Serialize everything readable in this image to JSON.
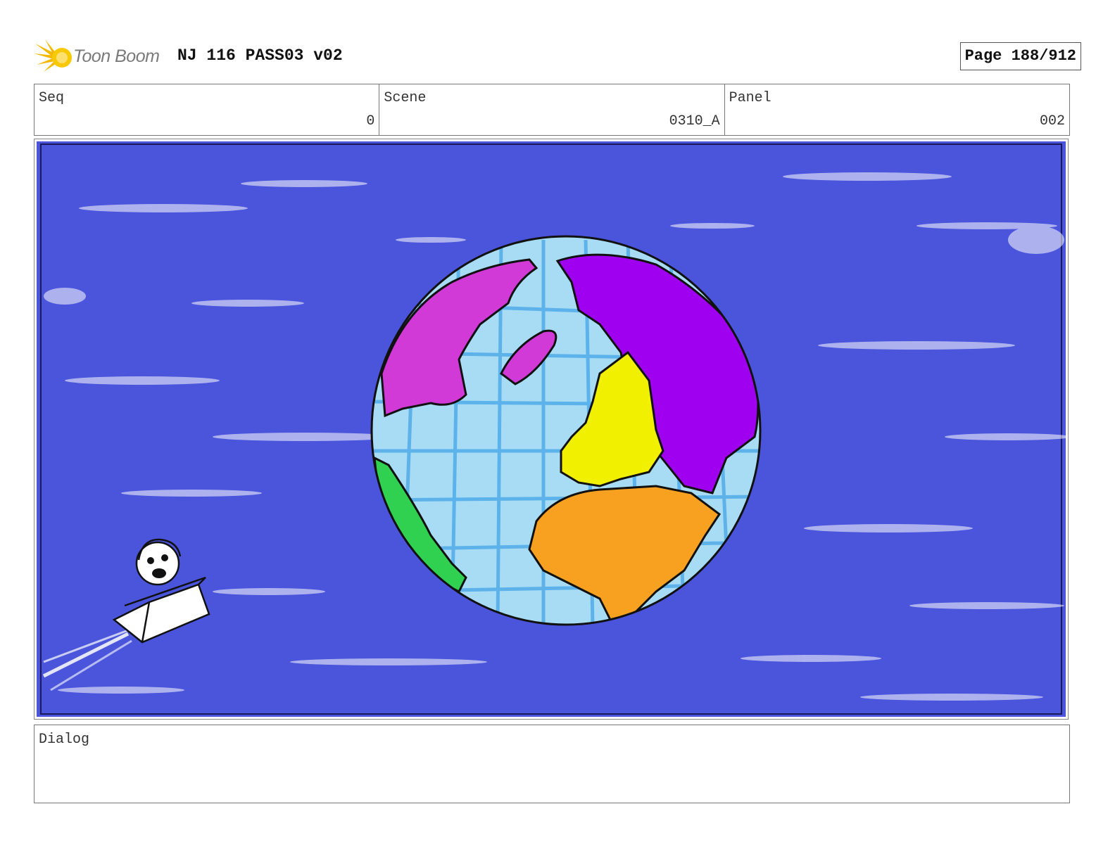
{
  "header": {
    "brand": "Toon Boom",
    "title": "NJ 116 PASS03 v02",
    "page": "Page 188/912"
  },
  "info": {
    "seq_label": "Seq",
    "seq_value": "0",
    "scene_label": "Scene",
    "scene_value": "0310_A",
    "panel_label": "Panel",
    "panel_value": "002"
  },
  "panel_art": {
    "description_icons": [
      "globe-icon",
      "kid-in-box-icon",
      "star-cloud-icon"
    ],
    "colors": {
      "space": "#4a55dc",
      "ocean": "#a8dcf4",
      "grid": "#4aa8e8",
      "north_america": "#d23ad8",
      "eurasia": "#a000f0",
      "europe": "#f0f000",
      "africa": "#f8a020",
      "south_america": "#30d050"
    }
  },
  "dialog": {
    "label": "Dialog"
  }
}
